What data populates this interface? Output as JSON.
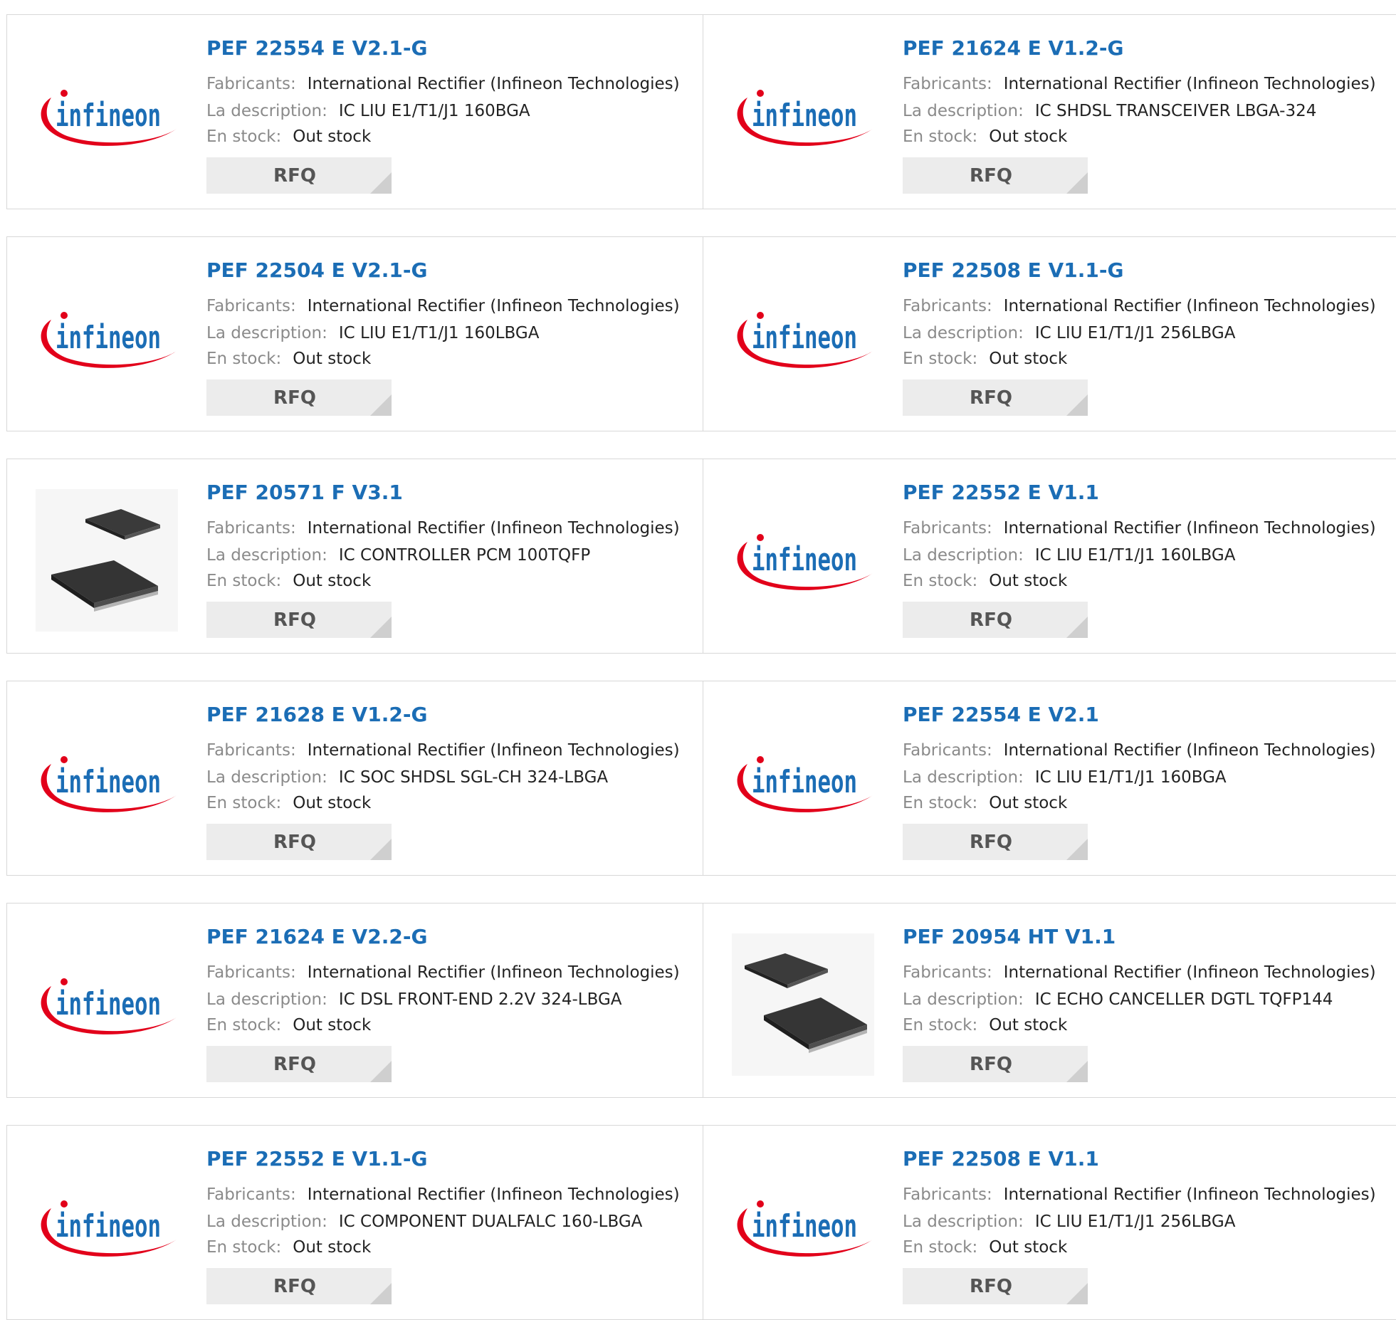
{
  "labels": {
    "manufacturer": "Fabricants:",
    "description": "La description:",
    "stock": "En stock:",
    "rfq": "RFQ"
  },
  "colors": {
    "title_link": "#1b6db5",
    "label_gray": "#8a8a8a",
    "border": "#d8d8d8",
    "rfq_bg": "#ececec",
    "infineon_logo_text": "#1b6db5",
    "infineon_logo_swoosh": "#e2001a"
  },
  "products": [
    {
      "part": "PEF 22554 E V2.1-G",
      "manufacturer": "International Rectifier (Infineon Technologies)",
      "description": "IC LIU E1/T1/J1 160BGA",
      "stock": "Out stock",
      "image": "infineon-logo",
      "logo_text": "infineon"
    },
    {
      "part": "PEF 21624 E V1.2-G",
      "manufacturer": "International Rectifier (Infineon Technologies)",
      "description": "IC SHDSL TRANSCEIVER LBGA-324",
      "stock": "Out stock",
      "image": "infineon-logo",
      "logo_text": "infineon"
    },
    {
      "part": "PEF 22504 E V2.1-G",
      "manufacturer": "International Rectifier (Infineon Technologies)",
      "description": "IC LIU E1/T1/J1 160LBGA",
      "stock": "Out stock",
      "image": "infineon-logo",
      "logo_text": "infineon"
    },
    {
      "part": "PEF 22508 E V1.1-G",
      "manufacturer": "International Rectifier (Infineon Technologies)",
      "description": "IC LIU E1/T1/J1 256LBGA",
      "stock": "Out stock",
      "image": "infineon-logo",
      "logo_text": "infineon"
    },
    {
      "part": "PEF 20571 F V3.1",
      "manufacturer": "International Rectifier (Infineon Technologies)",
      "description": "IC CONTROLLER PCM 100TQFP",
      "stock": "Out stock",
      "image": "chip-photo"
    },
    {
      "part": "PEF 22552 E V1.1",
      "manufacturer": "International Rectifier (Infineon Technologies)",
      "description": "IC LIU E1/T1/J1 160LBGA",
      "stock": "Out stock",
      "image": "infineon-logo",
      "logo_text": "infineon"
    },
    {
      "part": "PEF 21628 E V1.2-G",
      "manufacturer": "International Rectifier (Infineon Technologies)",
      "description": "IC SOC SHDSL SGL-CH 324-LBGA",
      "stock": "Out stock",
      "image": "infineon-logo",
      "logo_text": "infineon"
    },
    {
      "part": "PEF 22554 E V2.1",
      "manufacturer": "International Rectifier (Infineon Technologies)",
      "description": "IC LIU E1/T1/J1 160BGA",
      "stock": "Out stock",
      "image": "infineon-logo",
      "logo_text": "infineon"
    },
    {
      "part": "PEF 21624 E V2.2-G",
      "manufacturer": "International Rectifier (Infineon Technologies)",
      "description": "IC DSL FRONT-END 2.2V 324-LBGA",
      "stock": "Out stock",
      "image": "infineon-logo",
      "logo_text": "infineon"
    },
    {
      "part": "PEF 20954 HT V1.1",
      "manufacturer": "International Rectifier (Infineon Technologies)",
      "description": "IC ECHO CANCELLER DGTL TQFP144",
      "stock": "Out stock",
      "image": "chip-photo"
    },
    {
      "part": "PEF 22552 E V1.1-G",
      "manufacturer": "International Rectifier (Infineon Technologies)",
      "description": "IC COMPONENT DUALFALC 160-LBGA",
      "stock": "Out stock",
      "image": "infineon-logo",
      "logo_text": "infineon"
    },
    {
      "part": "PEF 22508 E V1.1",
      "manufacturer": "International Rectifier (Infineon Technologies)",
      "description": "IC LIU E1/T1/J1 256LBGA",
      "stock": "Out stock",
      "image": "infineon-logo",
      "logo_text": "infineon"
    }
  ]
}
